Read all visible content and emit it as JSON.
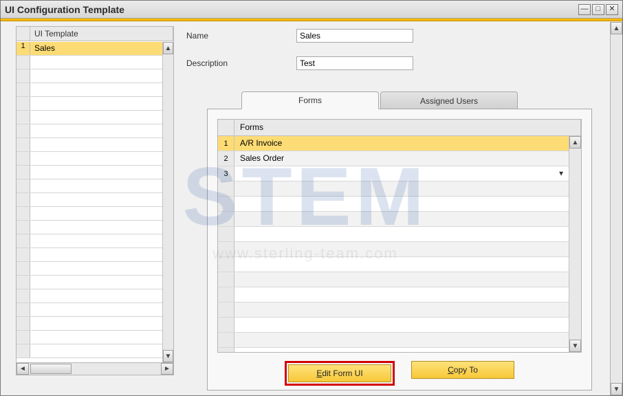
{
  "window": {
    "title": "UI Configuration Template",
    "controls": {
      "minimize": "—",
      "maximize": "□",
      "close": "✕"
    }
  },
  "sidebar": {
    "header": "UI Template",
    "rows": [
      {
        "num": "1",
        "value": "Sales",
        "selected": true
      }
    ],
    "empty_row_count": 22
  },
  "fields": {
    "name_label": "Name",
    "name_value": "Sales",
    "description_label": "Description",
    "description_value": "Test"
  },
  "tabs": {
    "forms_label": "Forms",
    "assigned_users_label": "Assigned Users",
    "active": "forms"
  },
  "forms_table": {
    "header": "Forms",
    "rows": [
      {
        "num": "1",
        "value": "A/R Invoice",
        "selected": true
      },
      {
        "num": "2",
        "value": "Sales Order",
        "selected": false
      },
      {
        "num": "3",
        "value": "",
        "dropdown": true
      }
    ],
    "empty_row_count": 12
  },
  "buttons": {
    "edit_form_ui_label": "Edit Form UI",
    "edit_mnemonic": "E",
    "copy_to_label": "Copy To",
    "copy_mnemonic": "C"
  },
  "watermark": {
    "logo_text": "STEM",
    "url_text": "www.sterling-team.com"
  },
  "colors": {
    "accent": "#f8b800",
    "selection": "#fddc75",
    "button": "#f7c838",
    "highlight": "#d10000"
  }
}
